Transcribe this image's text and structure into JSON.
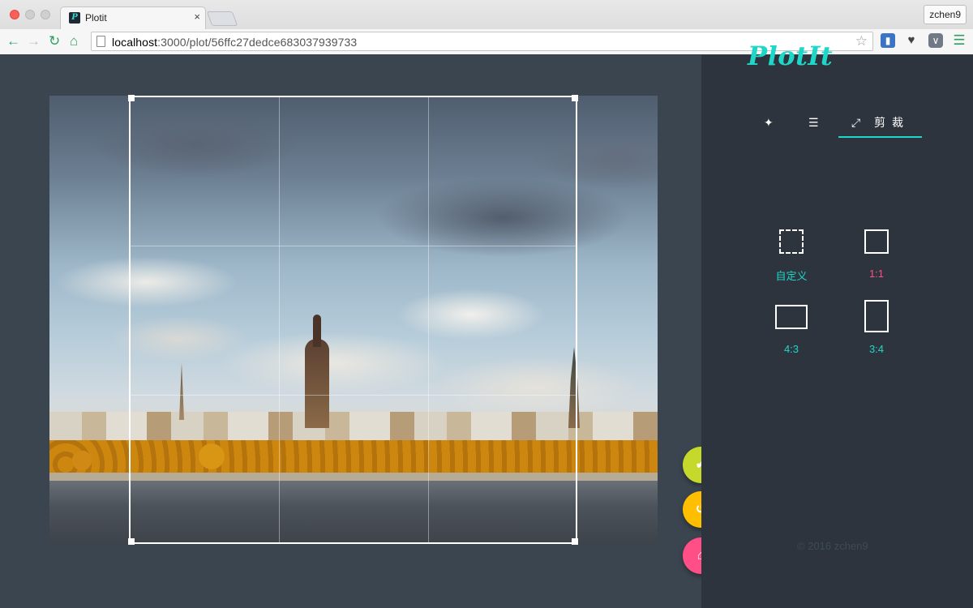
{
  "browser": {
    "tab_title": "Plotit",
    "tab_close": "×",
    "favicon_letter": "P",
    "profile_name": "zchen9",
    "url_host": "localhost",
    "url_path": ":3000/plot/56ffc27dedce683037939733",
    "icons": [
      "back-arrow-icon",
      "forward-arrow-icon",
      "reload-icon",
      "home-icon",
      "page-icon",
      "bookmark-star-icon",
      "extension-icons",
      "menu-icon"
    ]
  },
  "app": {
    "logo": "PlotIt",
    "tools": {
      "wand_icon": "magic-wand-icon",
      "adjust_icon": "sliders-icon",
      "crop_icon": "expand-arrows-icon",
      "crop_label": "剪裁"
    },
    "ratios": [
      {
        "label": "自定义",
        "color": "#1ed7c8"
      },
      {
        "label": "1:1",
        "color": "#ff4f86"
      },
      {
        "label": "4:3",
        "color": "#1ed7c8"
      },
      {
        "label": "3:4",
        "color": "#1ed7c8"
      }
    ],
    "fab_confirm_icon": "✔",
    "fab_reset_icon": "↺",
    "fab_home_icon": "⌂",
    "footer": "© 2016 zchen9"
  },
  "colors": {
    "accent": "#1ed7c8",
    "pink": "#ff4f86",
    "lime": "#c5d92c",
    "amber": "#ffbf00",
    "stage_bg": "#3b4550",
    "sidebar_bg": "#2d343d"
  }
}
